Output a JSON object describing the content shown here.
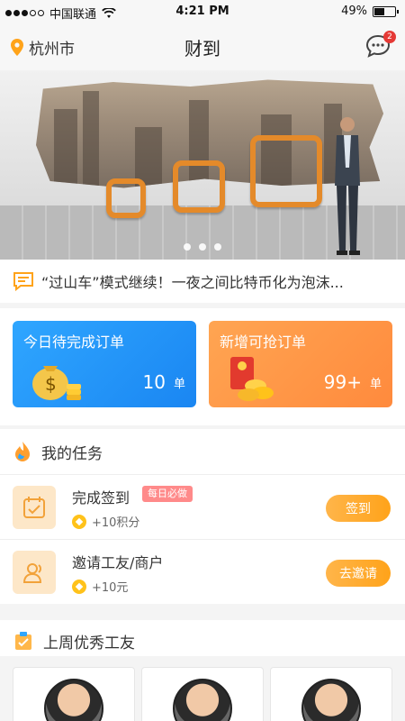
{
  "status_bar": {
    "carrier": "中国联通",
    "time": "4:21 PM",
    "battery": "49%",
    "battery_level": 0.49
  },
  "nav": {
    "city": "杭州市",
    "title": "财到",
    "message_count": "2"
  },
  "banner": {
    "pages": 3,
    "active_page": 0
  },
  "news": {
    "text": "“过山车”模式继续！一夜之间比特币化为泡沫..."
  },
  "orders": {
    "pending": {
      "title": "今日待完成订单",
      "value": "10",
      "unit": "单"
    },
    "new": {
      "title": "新增可抢订单",
      "value": "99+",
      "unit": "单"
    }
  },
  "tasks_section": {
    "title": "我的任务"
  },
  "tasks": [
    {
      "title": "完成签到",
      "tag": "每日必做",
      "reward": "+10积分",
      "button": "签到"
    },
    {
      "title": "邀请工友/商户",
      "tag": "",
      "reward": "+10元",
      "button": "去邀请"
    }
  ],
  "workers_section": {
    "title": "上周优秀工友"
  },
  "colors": {
    "accent": "#ffa31a",
    "blue_card": "#1a86f2",
    "orange_card": "#ff8a3d",
    "badge": "#e53935"
  }
}
